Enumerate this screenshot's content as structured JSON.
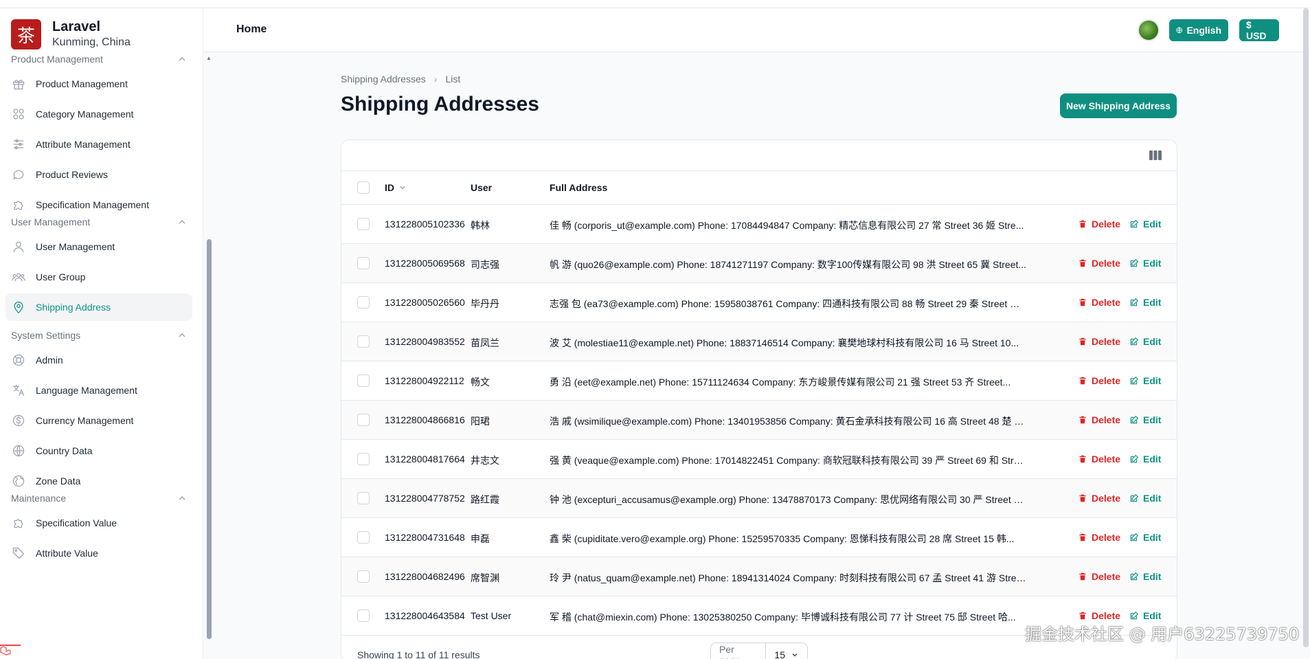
{
  "brand": {
    "logo_char": "茶",
    "name": "Laravel",
    "location": "Kunming, China"
  },
  "topbar": {
    "home": "Home",
    "language": "English",
    "currency": "$ USD"
  },
  "sidebar": {
    "groups": [
      {
        "title": "Product Management",
        "items": [
          {
            "label": "Product Management",
            "icon": "gift-icon"
          },
          {
            "label": "Category Management",
            "icon": "grid-icon"
          },
          {
            "label": "Attribute Management",
            "icon": "sliders-icon"
          },
          {
            "label": "Product Reviews",
            "icon": "chat-bubble-icon"
          },
          {
            "label": "Specification Management",
            "icon": "puzzle-icon"
          }
        ]
      },
      {
        "title": "User Management",
        "items": [
          {
            "label": "User Management",
            "icon": "user-icon"
          },
          {
            "label": "User Group",
            "icon": "user-group-icon"
          },
          {
            "label": "Shipping Address",
            "icon": "map-pin-icon",
            "active": true
          }
        ]
      },
      {
        "title": "System Settings",
        "items": [
          {
            "label": "Admin",
            "icon": "lifebuoy-icon"
          },
          {
            "label": "Language Management",
            "icon": "language-icon"
          },
          {
            "label": "Currency Management",
            "icon": "dollar-icon"
          },
          {
            "label": "Country Data",
            "icon": "globe-icon"
          },
          {
            "label": "Zone Data",
            "icon": "globe-alt-icon"
          }
        ]
      },
      {
        "title": "Maintenance",
        "items": [
          {
            "label": "Specification Value",
            "icon": "puzzle-icon"
          },
          {
            "label": "Attribute Value",
            "icon": "tag-icon"
          }
        ]
      }
    ]
  },
  "breadcrumb": {
    "parent": "Shipping Addresses",
    "current": "List"
  },
  "page": {
    "title": "Shipping Addresses",
    "new_button": "New Shipping Address"
  },
  "table": {
    "headers": {
      "id": "ID",
      "user": "User",
      "address": "Full Address"
    },
    "actions": {
      "delete": "Delete",
      "edit": "Edit"
    },
    "rows": [
      {
        "id": "131228005102336",
        "user": "韩林",
        "address": "佳 畅 (corporis_ut@example.com) Phone: 17084494847 Company: 精芯信息有限公司 27 常 Street 36 姬 Stre..."
      },
      {
        "id": "131228005069568",
        "user": "司志强",
        "address": "帆 游 (quo26@example.com) Phone: 18741271197 Company: 数字100传媒有限公司 98 洪 Street 65 冀 Street..."
      },
      {
        "id": "131228005026560",
        "user": "毕丹丹",
        "address": "志强 包 (ea73@example.com) Phone: 15958038761 Company: 四通科技有限公司 88 畅 Street 29 秦 Street 济..."
      },
      {
        "id": "131228004983552",
        "user": "苗凤兰",
        "address": "波 艾 (molestiae11@example.net) Phone: 18837146514 Company: 襄樊地球村科技有限公司 16 马 Street 10..."
      },
      {
        "id": "131228004922112",
        "user": "畅文",
        "address": "勇 沿 (eet@example.net) Phone: 15711124634 Company: 东方峻景传媒有限公司 21 强 Street 53 齐 Street..."
      },
      {
        "id": "131228004866816",
        "user": "阳珺",
        "address": "浩 戚 (wsimilique@example.com) Phone: 13401953856 Company: 黄石金承科技有限公司 16 高 Street 48 楚 S..."
      },
      {
        "id": "131228004817664",
        "user": "井志文",
        "address": "强 黄 (veaque@example.com) Phone: 17014822451 Company: 商软冠联科技有限公司 39 严 Street 69 和 Stree..."
      },
      {
        "id": "131228004778752",
        "user": "路红霞",
        "address": "钟 池 (excepturi_accusamus@example.org) Phone: 13478870173 Company: 思优网络有限公司 30 严 Street 56..."
      },
      {
        "id": "131228004731648",
        "user": "申磊",
        "address": "鑫 柴 (cupiditate.vero@example.org) Phone: 15259570335 Company: 恩悌科技有限公司 28 席 Street 15 韩..."
      },
      {
        "id": "131228004682496",
        "user": "席智渊",
        "address": "玲 尹 (natus_quam@example.net) Phone: 18941314024 Company: 时刻科技有限公司 67 孟 Street 41 游 Stree..."
      },
      {
        "id": "131228004643584",
        "user": "Test User",
        "address": "军 稽 (chat@miexin.com) Phone: 13025380250 Company: 毕博诚科技有限公司 77 计 Street 75 邸 Street 哈..."
      }
    ],
    "footer": {
      "showing": "Showing 1 to 11 of 11 results",
      "per_page_label": "Per page",
      "per_page_value": "15"
    }
  },
  "watermark": "掘金技术社区 @ 用户63225739750",
  "colors": {
    "accent": "#0f8f80",
    "danger": "#dc2626",
    "brand": "#b91c1c"
  }
}
